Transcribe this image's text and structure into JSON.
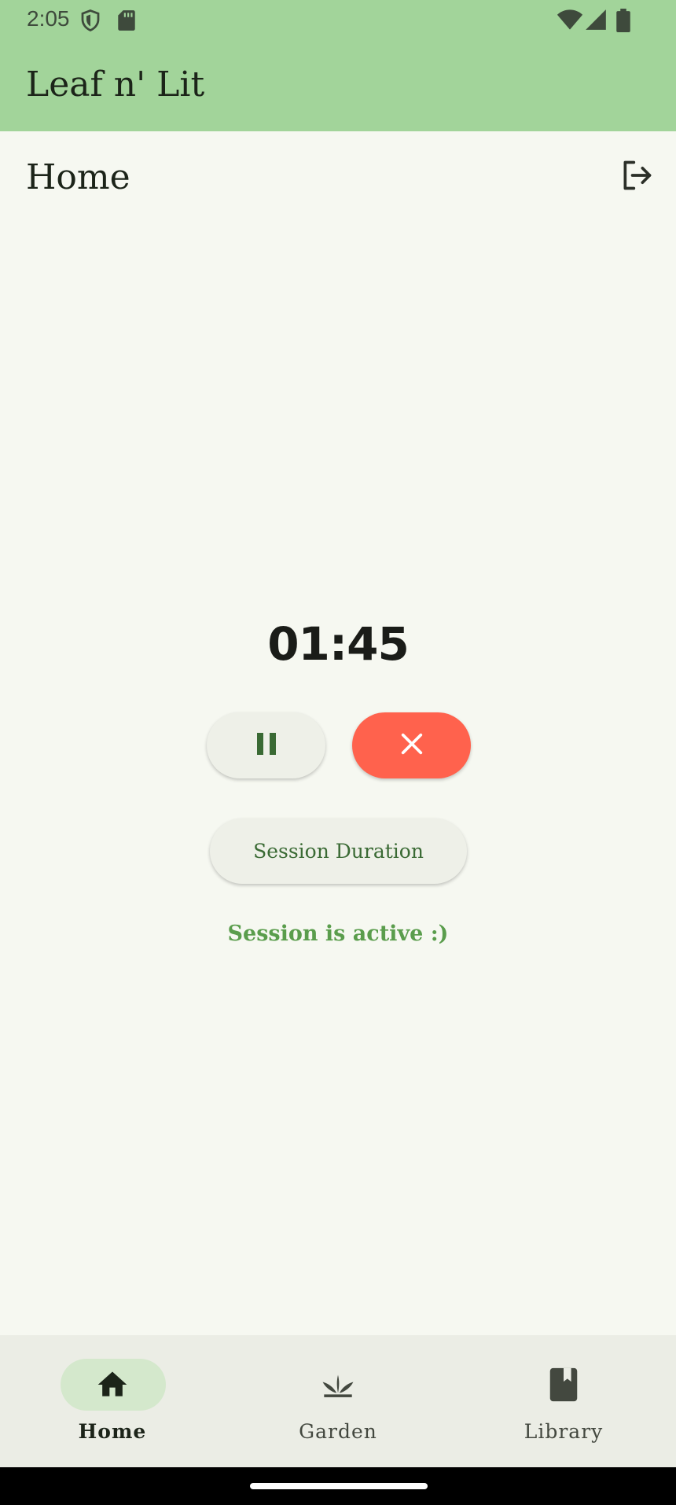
{
  "status_bar": {
    "time": "2:05",
    "icons": [
      "shield-icon",
      "sd-card-icon",
      "wifi-icon",
      "signal-icon",
      "battery-icon"
    ]
  },
  "app_bar": {
    "title": "Leaf n' Lit"
  },
  "page": {
    "title": "Home",
    "logout_icon": "logout-icon"
  },
  "timer": {
    "display": "01:45",
    "pause_icon": "pause-icon",
    "cancel_icon": "close-icon"
  },
  "session": {
    "duration_button_label": "Session Duration",
    "status_text": "Session is active :)"
  },
  "bottom_nav": {
    "items": [
      {
        "label": "Home",
        "icon": "home-icon",
        "active": true
      },
      {
        "label": "Garden",
        "icon": "plant-icon",
        "active": false
      },
      {
        "label": "Library",
        "icon": "book-icon",
        "active": false
      }
    ]
  },
  "colors": {
    "app_bar": "#a2d49a",
    "background": "#f6f8f1",
    "cancel_button": "#ff624d",
    "status_text": "#5a9d4c",
    "nav_active_pill": "#d4e8cc"
  }
}
